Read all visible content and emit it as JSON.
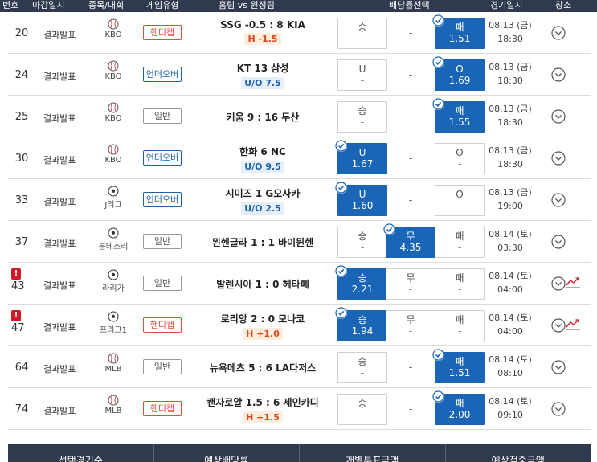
{
  "header": {
    "cols": [
      "번호",
      "마감일시",
      "종목/대회",
      "게임유형",
      "홈팀 vs 원정팀",
      "배당률선택",
      "경기일시",
      "장소"
    ]
  },
  "rows": [
    {
      "no": "20",
      "warn": false,
      "status": "결과발표",
      "sport": "baseball",
      "league": "KBO",
      "type": "핸디캡",
      "type_kind": "hc",
      "match": "SSG -0.5 : 8 KIA",
      "sub": "H -1.5",
      "sub_kind": "red",
      "odds": [
        {
          "label": "승",
          "value": "-",
          "sel": false,
          "dash": false
        },
        {
          "label": "-",
          "value": "",
          "sel": false,
          "dash": true
        },
        {
          "label": "패",
          "value": "1.51",
          "sel": true,
          "dash": false
        }
      ],
      "date": "08.13 (금)",
      "time": "18:30",
      "trend": false
    },
    {
      "no": "24",
      "warn": false,
      "status": "결과발표",
      "sport": "baseball",
      "league": "KBO",
      "type": "언더오버",
      "type_kind": "uo",
      "match": "KT   13   삼성",
      "sub": "U/O 7.5",
      "sub_kind": "blue",
      "odds": [
        {
          "label": "U",
          "value": "-",
          "sel": false,
          "dash": false
        },
        {
          "label": "-",
          "value": "",
          "sel": false,
          "dash": true
        },
        {
          "label": "O",
          "value": "1.69",
          "sel": true,
          "dash": false
        }
      ],
      "date": "08.13 (금)",
      "time": "18:30",
      "trend": false
    },
    {
      "no": "25",
      "warn": false,
      "status": "결과발표",
      "sport": "baseball",
      "league": "KBO",
      "type": "일반",
      "type_kind": "nm",
      "match": "키움 9 : 16 두산",
      "sub": "",
      "sub_kind": "",
      "odds": [
        {
          "label": "승",
          "value": "-",
          "sel": false,
          "dash": false
        },
        {
          "label": "-",
          "value": "",
          "sel": false,
          "dash": true
        },
        {
          "label": "패",
          "value": "1.55",
          "sel": true,
          "dash": false
        }
      ],
      "date": "08.13 (금)",
      "time": "18:30",
      "trend": false
    },
    {
      "no": "30",
      "warn": false,
      "status": "결과발표",
      "sport": "baseball",
      "league": "KBO",
      "type": "언더오버",
      "type_kind": "uo",
      "match": "한화   6   NC",
      "sub": "U/O 9.5",
      "sub_kind": "blue",
      "odds": [
        {
          "label": "U",
          "value": "1.67",
          "sel": true,
          "dash": false
        },
        {
          "label": "-",
          "value": "",
          "sel": false,
          "dash": true
        },
        {
          "label": "O",
          "value": "-",
          "sel": false,
          "dash": false
        }
      ],
      "date": "08.13 (금)",
      "time": "18:30",
      "trend": false
    },
    {
      "no": "33",
      "warn": false,
      "status": "결과발표",
      "sport": "soccer",
      "league": "J리그",
      "type": "언더오버",
      "type_kind": "uo",
      "match": "시미즈   1   G오사카",
      "sub": "U/O 2.5",
      "sub_kind": "blue",
      "odds": [
        {
          "label": "U",
          "value": "1.60",
          "sel": true,
          "dash": false
        },
        {
          "label": "-",
          "value": "",
          "sel": false,
          "dash": true
        },
        {
          "label": "O",
          "value": "-",
          "sel": false,
          "dash": false
        }
      ],
      "date": "08.13 (금)",
      "time": "19:00",
      "trend": false
    },
    {
      "no": "37",
      "warn": false,
      "status": "결과발표",
      "sport": "soccer",
      "league": "분데스리",
      "type": "일반",
      "type_kind": "nm",
      "match": "묀헨글라 1 : 1 바이뮌헨",
      "sub": "",
      "sub_kind": "",
      "odds": [
        {
          "label": "승",
          "value": "-",
          "sel": false,
          "dash": false
        },
        {
          "label": "무",
          "value": "4.35",
          "sel": true,
          "dash": false
        },
        {
          "label": "패",
          "value": "-",
          "sel": false,
          "dash": false
        }
      ],
      "date": "08.14 (토)",
      "time": "03:30",
      "trend": false
    },
    {
      "no": "43",
      "warn": true,
      "status": "결과발표",
      "sport": "soccer",
      "league": "라리가",
      "type": "일반",
      "type_kind": "nm",
      "match": "발렌시아 1 : 0 헤타페",
      "sub": "",
      "sub_kind": "",
      "odds": [
        {
          "label": "승",
          "value": "2.21",
          "sel": true,
          "dash": false
        },
        {
          "label": "무",
          "value": "-",
          "sel": false,
          "dash": false
        },
        {
          "label": "패",
          "value": "-",
          "sel": false,
          "dash": false
        }
      ],
      "date": "08.14 (토)",
      "time": "04:00",
      "trend": true
    },
    {
      "no": "47",
      "warn": true,
      "status": "결과발표",
      "sport": "soccer",
      "league": "프리그1",
      "type": "핸디캡",
      "type_kind": "hc",
      "match": "로리앙 2 : 0 모나코",
      "sub": "H +1.0",
      "sub_kind": "red",
      "odds": [
        {
          "label": "승",
          "value": "1.94",
          "sel": true,
          "dash": false
        },
        {
          "label": "무",
          "value": "-",
          "sel": false,
          "dash": false
        },
        {
          "label": "패",
          "value": "-",
          "sel": false,
          "dash": false
        }
      ],
      "date": "08.14 (토)",
      "time": "04:00",
      "trend": true
    },
    {
      "no": "64",
      "warn": false,
      "status": "결과발표",
      "sport": "baseball",
      "league": "MLB",
      "type": "일반",
      "type_kind": "nm",
      "match": "뉴욕메츠 5 : 6 LA다저스",
      "sub": "",
      "sub_kind": "",
      "odds": [
        {
          "label": "승",
          "value": "-",
          "sel": false,
          "dash": false
        },
        {
          "label": "-",
          "value": "",
          "sel": false,
          "dash": true
        },
        {
          "label": "패",
          "value": "1.51",
          "sel": true,
          "dash": false
        }
      ],
      "date": "08.14 (토)",
      "time": "08:10",
      "trend": false
    },
    {
      "no": "74",
      "warn": false,
      "status": "결과발표",
      "sport": "baseball",
      "league": "MLB",
      "type": "핸디캡",
      "type_kind": "hc",
      "match": "캔자로얄 1.5 : 6 세인카디",
      "sub": "H +1.5",
      "sub_kind": "red",
      "odds": [
        {
          "label": "승",
          "value": "-",
          "sel": false,
          "dash": false
        },
        {
          "label": "-",
          "value": "",
          "sel": false,
          "dash": true
        },
        {
          "label": "패",
          "value": "2.00",
          "sel": true,
          "dash": false
        }
      ],
      "date": "08.14 (토)",
      "time": "09:10",
      "trend": false
    }
  ],
  "footer": {
    "cols": [
      "선택경기수",
      "예상배당률",
      "개별투표금액",
      "예상적중금액"
    ]
  },
  "colors": {
    "selected": "#1a65b5",
    "handicap": "#e34c39",
    "underover": "#1d62a7",
    "warning": "#d2182b",
    "header_bg": "#2f3a4e"
  }
}
